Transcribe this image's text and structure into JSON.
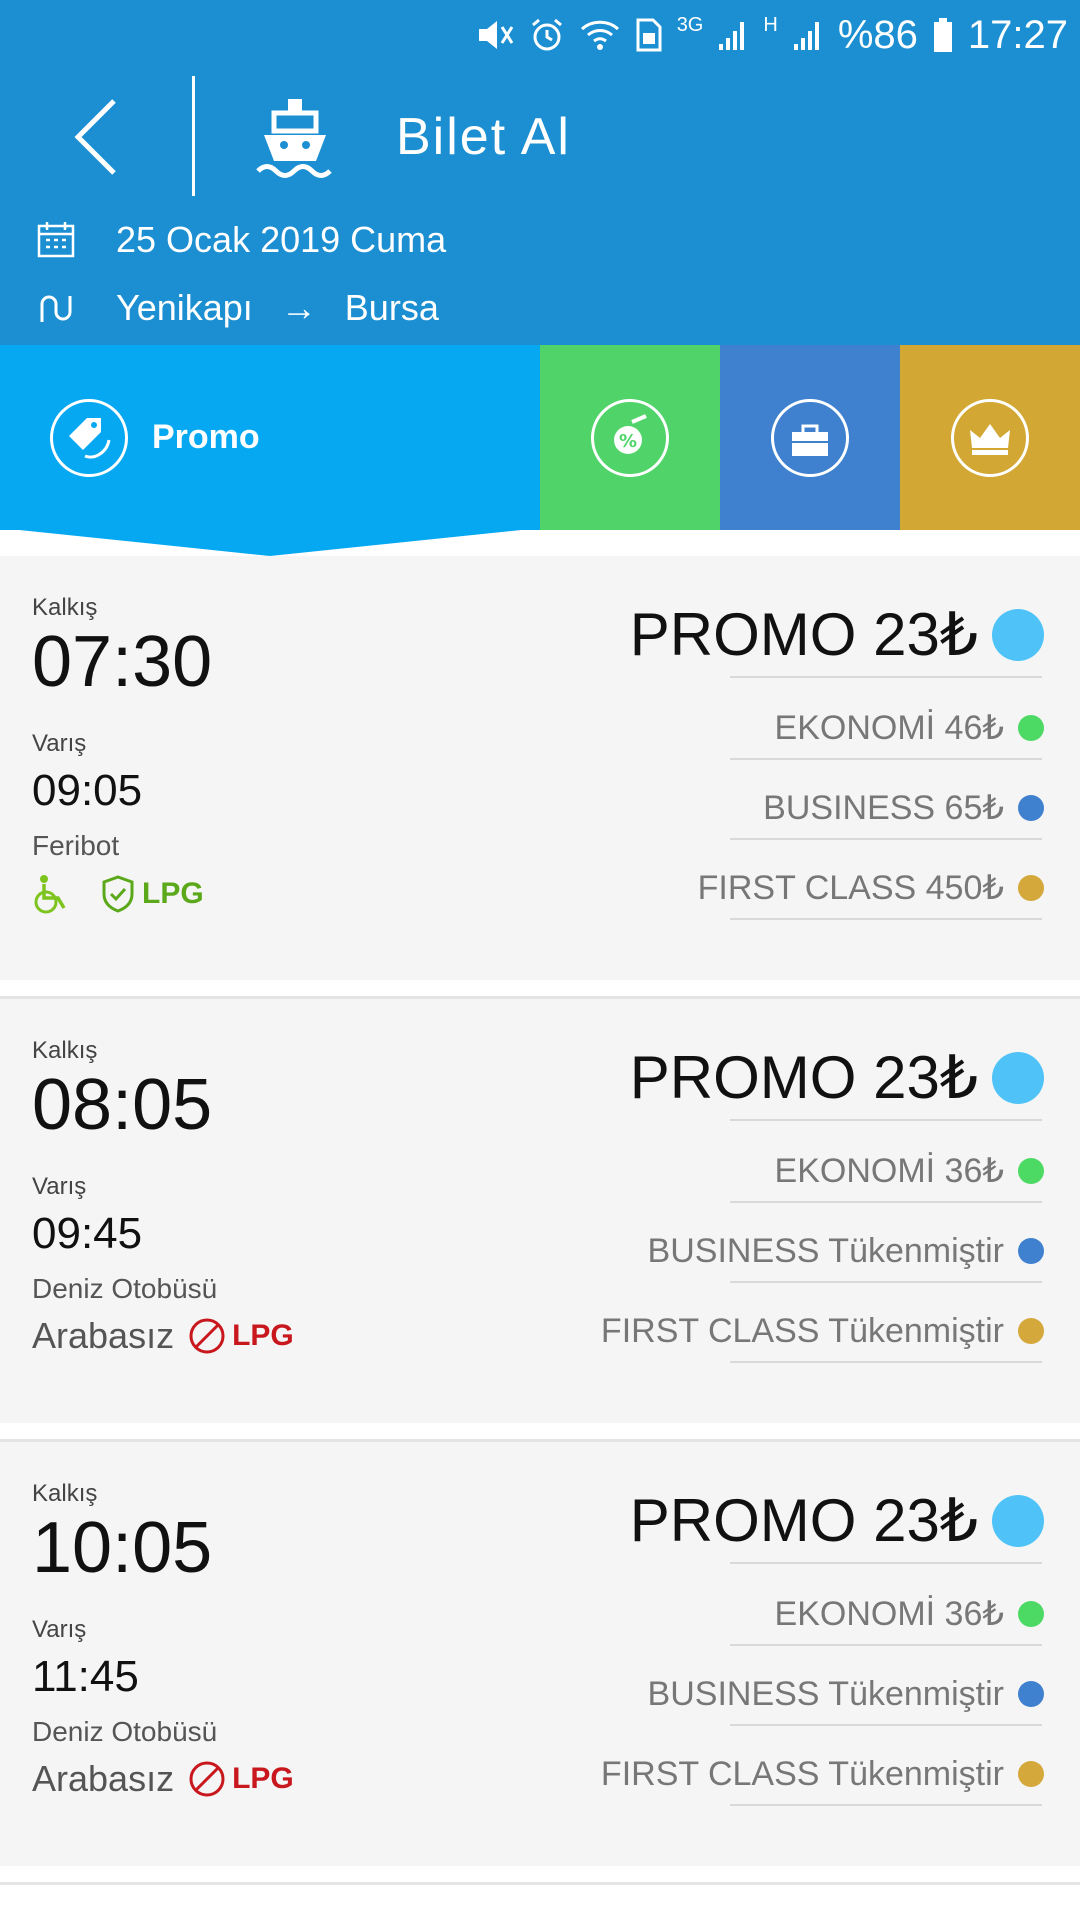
{
  "status_bar": {
    "network_3g": "3G",
    "network_h": "H",
    "battery": "%86",
    "time": "17:27"
  },
  "header": {
    "title": "Bilet Al",
    "date": "25 Ocak 2019 Cuma",
    "route_from": "Yenikapı",
    "route_arrow": "→",
    "route_to": "Bursa"
  },
  "tabs": [
    {
      "label": "Promo",
      "color": "#05a8f1",
      "selected": true
    },
    {
      "label": "",
      "color": "#50d46a",
      "selected": false
    },
    {
      "label": "",
      "color": "#3f80cf",
      "selected": false
    },
    {
      "label": "",
      "color": "#d2a734",
      "selected": false
    }
  ],
  "labels": {
    "departure": "Kalkış",
    "arrival": "Varış"
  },
  "colors": {
    "promo": "#4fc3f7",
    "ekonomi": "#4cd964",
    "business": "#3f80cf",
    "first_class": "#d4a83a"
  },
  "trips": [
    {
      "departure": "07:30",
      "arrival": "09:05",
      "vessel": "Feribot",
      "features": [
        "wheelchair-icon",
        "shield-check-icon",
        "LPG"
      ],
      "lpg_allowed": true,
      "car_note": "",
      "fares": {
        "promo": "PROMO 23₺",
        "ekonomi": "EKONOMİ 46₺",
        "business": "BUSINESS 65₺",
        "first_class": "FIRST CLASS 450₺"
      }
    },
    {
      "departure": "08:05",
      "arrival": "09:45",
      "vessel": "Deniz Otobüsü",
      "lpg_allowed": false,
      "car_note": "Arabasız",
      "lpg_label": "LPG",
      "fares": {
        "promo": "PROMO 23₺",
        "ekonomi": "EKONOMİ 36₺",
        "business": "BUSINESS Tükenmiştir",
        "first_class": "FIRST CLASS Tükenmiştir"
      }
    },
    {
      "departure": "10:05",
      "arrival": "11:45",
      "vessel": "Deniz Otobüsü",
      "lpg_allowed": false,
      "car_note": "Arabasız",
      "lpg_label": "LPG",
      "fares": {
        "promo": "PROMO 23₺",
        "ekonomi": "EKONOMİ 36₺",
        "business": "BUSINESS Tükenmiştir",
        "first_class": "FIRST CLASS Tükenmiştir"
      }
    }
  ]
}
